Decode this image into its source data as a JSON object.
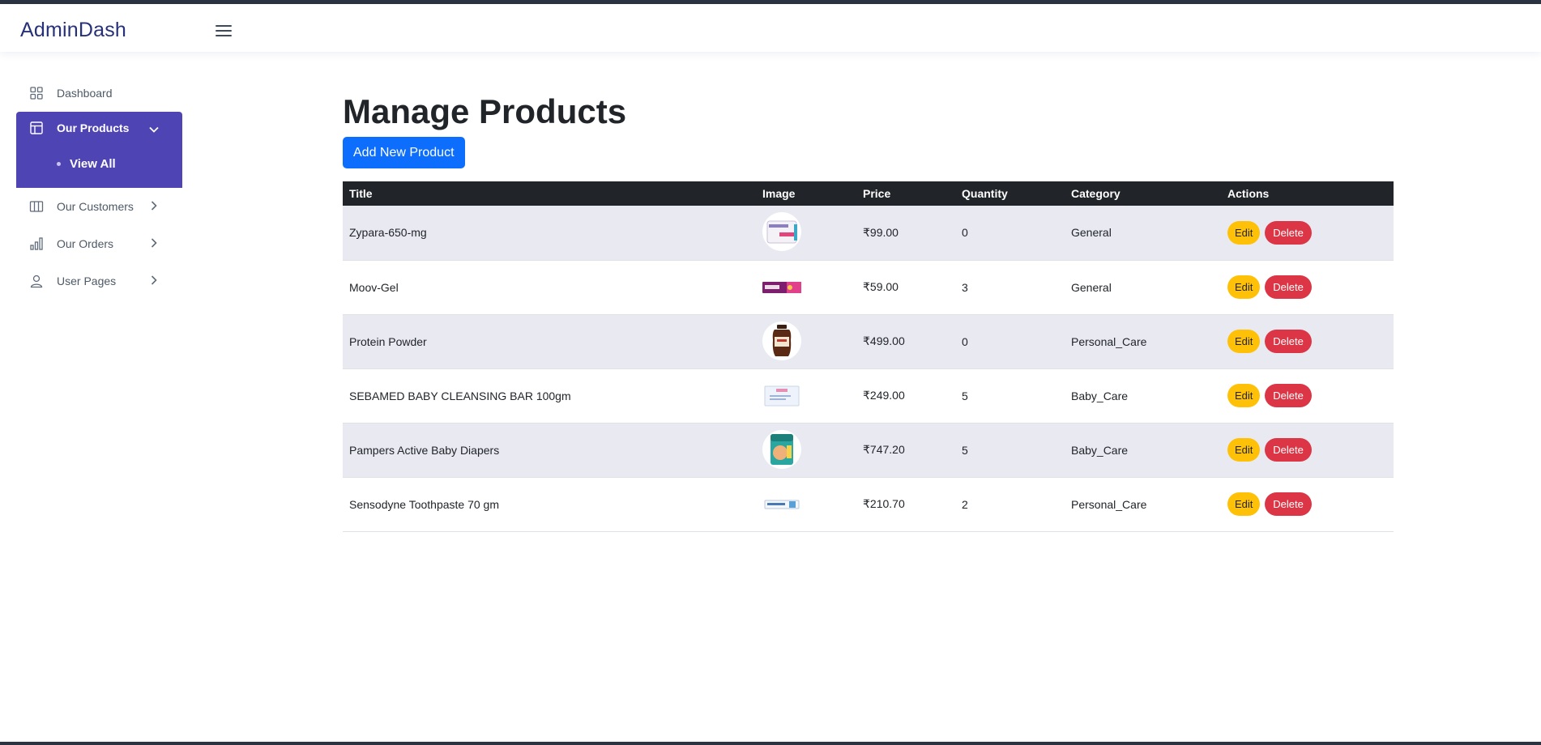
{
  "app": {
    "title": "AdminDash"
  },
  "sidebar": {
    "items": [
      {
        "label": "Dashboard",
        "icon": "grid-icon"
      },
      {
        "label": "Our Products",
        "icon": "layout-icon",
        "expanded": true,
        "sub": [
          {
            "label": "View All"
          }
        ]
      },
      {
        "label": "Our Customers",
        "icon": "columns-icon"
      },
      {
        "label": "Our Orders",
        "icon": "bar-chart-icon"
      },
      {
        "label": "User Pages",
        "icon": "person-icon"
      }
    ]
  },
  "main": {
    "title": "Manage Products",
    "add_button": "Add New Product",
    "columns": [
      "Title",
      "Image",
      "Price",
      "Quantity",
      "Category",
      "Actions"
    ],
    "rows": [
      {
        "title": "Zypara-650-mg",
        "image": "medicine-box",
        "price": "₹99.00",
        "quantity": "0",
        "category": "General"
      },
      {
        "title": "Moov-Gel",
        "image": "moov-tube",
        "price": "₹59.00",
        "quantity": "3",
        "category": "General"
      },
      {
        "title": "Protein Powder",
        "image": "protein-jar",
        "price": "₹499.00",
        "quantity": "0",
        "category": "Personal_Care"
      },
      {
        "title": "SEBAMED BABY CLEANSING BAR 100gm",
        "image": "soap-box",
        "price": "₹249.00",
        "quantity": "5",
        "category": "Baby_Care"
      },
      {
        "title": "Pampers Active Baby Diapers",
        "image": "diaper-pack",
        "price": "₹747.20",
        "quantity": "5",
        "category": "Baby_Care"
      },
      {
        "title": "Sensodyne Toothpaste 70 gm",
        "image": "toothpaste-box",
        "price": "₹210.70",
        "quantity": "2",
        "category": "Personal_Care"
      }
    ],
    "edit_label": "Edit",
    "delete_label": "Delete"
  },
  "colors": {
    "accent": "#4f44b3",
    "primary": "#0d6efd",
    "warning": "#ffc107",
    "danger": "#dc3545",
    "table_header": "#212529",
    "stripe": "#e9e9f2"
  }
}
